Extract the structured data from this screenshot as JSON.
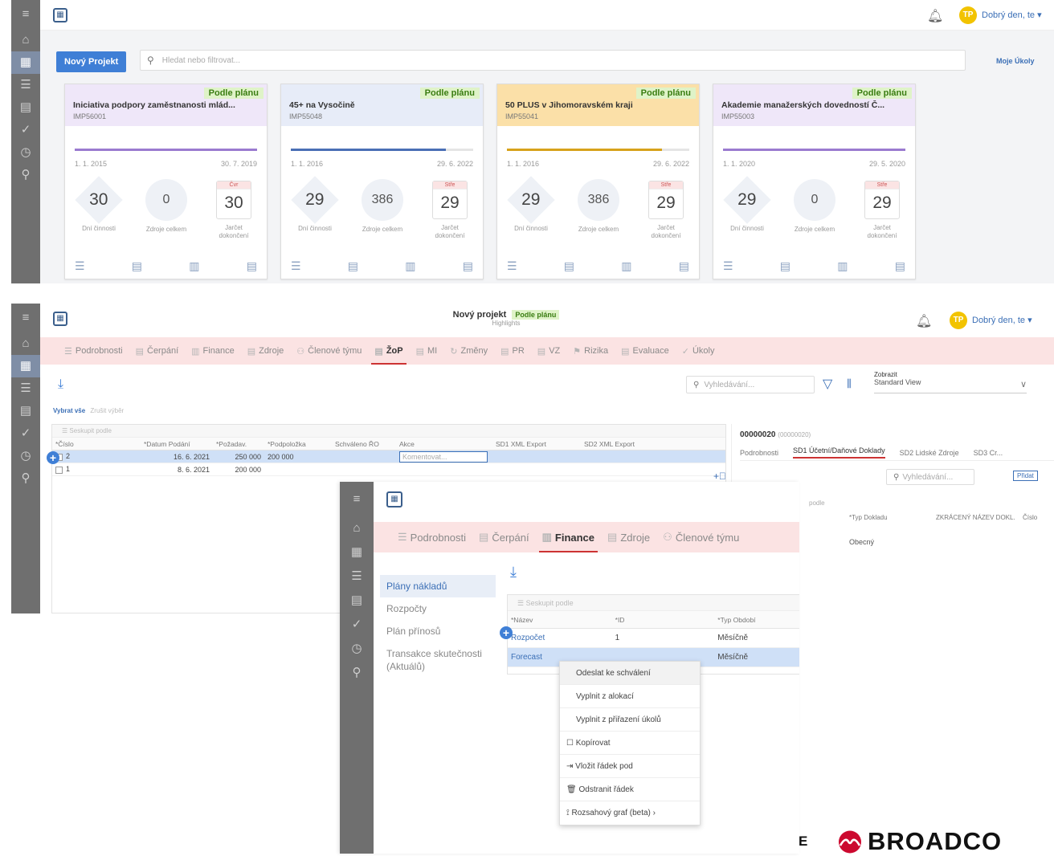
{
  "screen1": {
    "rail_icons": [
      "menu-icon",
      "home-icon",
      "grid-icon",
      "list-icon",
      "stack-icon",
      "check-icon",
      "clock-icon",
      "link-icon"
    ],
    "new_project": "Nový Projekt",
    "search_placeholder": "Hledat nebo filtrovat...",
    "my_tasks": "Moje Úkoly",
    "avatar": "TP",
    "greeting": "Dobrý den, te ▾",
    "cards": [
      {
        "status": "Podle plánu",
        "title": "Iniciativa podpory zaměstnanosti mlád...",
        "code": "IMP56001",
        "start": "1. 1. 2015",
        "end": "30. 7. 2019",
        "m1_small": "Čvr",
        "m1": "30",
        "m1_lbl": "Dní činnosti",
        "m2": "0",
        "m2_lbl": "Zdroje celkem",
        "m3_small": "Čvr",
        "m3": "30",
        "m3_lbl": "Jarčet dokončení",
        "bg": "#efe7f9",
        "bar": "#9b7bd0",
        "progress": 1.0
      },
      {
        "status": "Podle plánu",
        "title": "45+ na Vysočině",
        "code": "IMP55048",
        "start": "1. 1. 2016",
        "end": "29. 6. 2022",
        "m1_small": "Stře",
        "m1": "29",
        "m1_lbl": "Dní činnosti",
        "m2": "386",
        "m2_lbl": "Zdroje celkem",
        "m3_small": "Stře",
        "m3": "29",
        "m3_lbl": "Jarčet dokončení",
        "bg": "#e7ecf8",
        "bar": "#4a6fb5",
        "progress": 0.85
      },
      {
        "status": "Podle plánu",
        "title": "50 PLUS v Jihomoravském kraji",
        "code": "IMP55041",
        "start": "1. 1. 2016",
        "end": "29. 6. 2022",
        "m1_small": "Stře",
        "m1": "29",
        "m1_lbl": "Dní činnosti",
        "m2": "386",
        "m2_lbl": "Zdroje celkem",
        "m3_small": "Stře",
        "m3": "29",
        "m3_lbl": "Jarčet dokončení",
        "bg": "#fbe0a8",
        "bar": "#d7a21b",
        "progress": 0.85
      },
      {
        "status": "Podle plánu",
        "title": "Akademie manažerských dovedností Č...",
        "code": "IMP55003",
        "start": "1. 1. 2020",
        "end": "29. 5. 2020",
        "m1_small": "Stře",
        "m1": "29",
        "m1_lbl": "Dní činnosti",
        "m2": "0",
        "m2_lbl": "Zdroje celkem",
        "m3_small": "Stře",
        "m3": "29",
        "m3_lbl": "Jarčet dokončení",
        "bg": "#efe7f9",
        "bar": "#9b7bd0",
        "progress": 1.0
      }
    ]
  },
  "screen2": {
    "title": "Nový projekt",
    "status": "Podle plánu",
    "subtitle": "Highlights",
    "avatar": "TP",
    "greeting": "Dobrý den, te ▾",
    "tabs": [
      {
        "icon": "☰",
        "label": "Podrobnosti"
      },
      {
        "icon": "▤",
        "label": "Čerpání"
      },
      {
        "icon": "▥",
        "label": "Finance"
      },
      {
        "icon": "▤",
        "label": "Zdroje"
      },
      {
        "icon": "⚇",
        "label": "Členové týmu"
      },
      {
        "icon": "▤",
        "label": "ŽoP",
        "active": true
      },
      {
        "icon": "▤",
        "label": "MI"
      },
      {
        "icon": "↻",
        "label": "Změny"
      },
      {
        "icon": "▤",
        "label": "PR"
      },
      {
        "icon": "▤",
        "label": "VZ"
      },
      {
        "icon": "⚑",
        "label": "Rizika"
      },
      {
        "icon": "▤",
        "label": "Evaluace"
      },
      {
        "icon": "✓",
        "label": "Úkoly"
      }
    ],
    "search_placeholder": "Vyhledávání...",
    "view_label": "Zobrazit",
    "view_value": "Standard View",
    "selected_label": "Vybrat vše",
    "selected_hint": "Zrušit výběr",
    "group_by": "Seskupit podle",
    "columns": [
      "*Číslo",
      "*Datum Podání",
      "*Požadav.",
      "*Podpoložka",
      "Schváleno ŘO",
      "Akce",
      "SD1 XML Export",
      "SD2 XML Export"
    ],
    "rows": [
      {
        "no": "2",
        "date": "16. 6. 2021",
        "req": "250 000",
        "sub": "200 000",
        "action": "Komentovat..."
      },
      {
        "no": "1",
        "date": "8. 6. 2021",
        "req": "200 000",
        "sub": "",
        "action": ""
      }
    ],
    "detail": {
      "id": "00000020",
      "id_suffix": "(00000020)",
      "tabs": [
        "Podrobnosti",
        "SD1 Účetní/Daňové Doklady",
        "SD2 Lidské Zdroje",
        "SD3 Cr..."
      ],
      "search_placeholder": "Vyhledávání...",
      "add_label": "Přidat",
      "group_by": "podle",
      "columns": [
        "*Typ Dokladu",
        "ZKRÁCENÝ NÁZEV DOKL.",
        "Číslo"
      ],
      "row_type": "Obecný"
    }
  },
  "screen3": {
    "tabs": [
      {
        "icon": "☰",
        "label": "Podrobnosti"
      },
      {
        "icon": "▤",
        "label": "Čerpání"
      },
      {
        "icon": "▥",
        "label": "Finance",
        "active": true
      },
      {
        "icon": "▤",
        "label": "Zdroje"
      },
      {
        "icon": "⚇",
        "label": "Členové týmu"
      }
    ],
    "leftnav": [
      "Plány nákladů",
      "Rozpočty",
      "Plán přínosů",
      "Transakce skutečnosti (Aktuálů)"
    ],
    "group_by": "Seskupit podle",
    "columns": [
      "*Název",
      "*ID",
      "*Typ Období"
    ],
    "rows": [
      {
        "name": "Rozpočet",
        "id": "1",
        "period": "Měsíčně"
      },
      {
        "name": "Forecast",
        "id": "",
        "period": "Měsíčně"
      }
    ],
    "menu": [
      "Odeslat ke schválení",
      "Vyplnit z alokací",
      "Vyplnit z přiřazení úkolů",
      "☐  Kopírovat",
      "⇥  Vložit řádek pod",
      "🗑  Odstranit řádek",
      "⟟  Rozsahový graf (beta)  ›"
    ]
  },
  "footer": {
    "left_text": "E",
    "brand": "BROADCO"
  }
}
